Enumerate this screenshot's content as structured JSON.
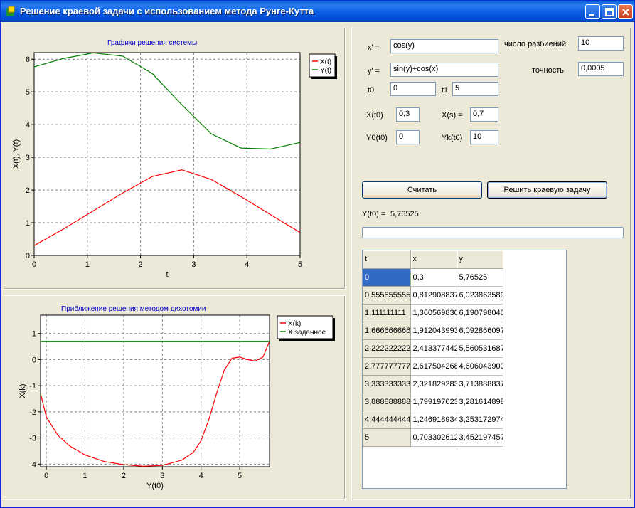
{
  "window": {
    "title": "Решение краевой задачи с использованием метода Рунге-Кутта"
  },
  "colors": {
    "accent_blue": "#0000c8",
    "series_red": "#ff0000",
    "series_green": "#008000"
  },
  "params": {
    "x_prime_label": "x' =",
    "x_prime_value": "cos(y)",
    "y_prime_label": "y' =",
    "y_prime_value": "sin(y)+cos(x)",
    "partitions_label": "число разбиений",
    "partitions_value": "10",
    "accuracy_label": "точность",
    "accuracy_value": "0,0005",
    "t0_label": "t0",
    "t0_value": "0",
    "t1_label": "t1",
    "t1_value": "5",
    "xt0_label": "X(t0)",
    "xt0_value": "0,3",
    "xs_label": "X(s) =",
    "xs_value": "0,7",
    "y0t0_label": "Y0(t0)",
    "y0t0_value": "0",
    "ykt0_label": "Yk(t0)",
    "ykt0_value": "10"
  },
  "buttons": {
    "compute": "Считать",
    "solve": "Решить краевую задачу"
  },
  "result": {
    "label": "Y(t0) =",
    "value": "5,76525"
  },
  "table": {
    "headers": [
      "t",
      "x",
      "y"
    ],
    "rows": [
      [
        "0",
        "0,3",
        "5,76525"
      ],
      [
        "0,555555555",
        "0,812908837",
        "6,023863589"
      ],
      [
        "1,111111111",
        "1,360569830",
        "6,190798040"
      ],
      [
        "1,666666666",
        "1,912043993",
        "6,092866097"
      ],
      [
        "2,222222222",
        "2,413377442",
        "5,560531687"
      ],
      [
        "2,777777777",
        "2,617504268",
        "4,606043900"
      ],
      [
        "3,333333333",
        "2,321829283",
        "3,713888837"
      ],
      [
        "3,888888888",
        "1,799197023",
        "3,281614898"
      ],
      [
        "4,444444444",
        "1,246918934",
        "3,253172974"
      ],
      [
        "5",
        "0,703302612",
        "3,452197457"
      ]
    ]
  },
  "chart_data": [
    {
      "type": "line",
      "title": "Графики решения системы",
      "xlabel": "t",
      "ylabel": "X(t), Y(t)",
      "xlim": [
        0,
        5
      ],
      "ylim": [
        0,
        6.2
      ],
      "xticks": [
        "0",
        "1",
        "2",
        "3",
        "4",
        "5"
      ],
      "yticks": [
        "0",
        "1",
        "2",
        "3",
        "4",
        "5",
        "6"
      ],
      "grid": true,
      "legend": "top-right",
      "series": [
        {
          "name": "X(t)",
          "color": "#ff0000",
          "x": [
            0,
            0.5556,
            1.1111,
            1.6667,
            2.2222,
            2.7778,
            3.3333,
            3.8889,
            4.4444,
            5
          ],
          "y": [
            0.3,
            0.813,
            1.361,
            1.912,
            2.413,
            2.618,
            2.322,
            1.799,
            1.247,
            0.703
          ]
        },
        {
          "name": "Y(t)",
          "color": "#008000",
          "x": [
            0,
            0.5556,
            1.1111,
            1.6667,
            2.2222,
            2.7778,
            3.3333,
            3.8889,
            4.4444,
            5
          ],
          "y": [
            5.765,
            6.024,
            6.191,
            6.093,
            5.561,
            4.606,
            3.714,
            3.282,
            3.253,
            3.452
          ]
        }
      ]
    },
    {
      "type": "line",
      "title": "Приближение решения методом дихотомии",
      "xlabel": "Y(t0)",
      "ylabel": "X(k)",
      "xlim": [
        -0.15,
        5.77
      ],
      "ylim": [
        -4.1,
        1.7
      ],
      "xticks": [
        "0",
        "1",
        "2",
        "3",
        "4",
        "5"
      ],
      "yticks": [
        "1",
        "0",
        "-1",
        "-2",
        "-3",
        "-4"
      ],
      "grid": true,
      "legend": "top-right",
      "series": [
        {
          "name": "X(k)",
          "color": "#ff0000",
          "x": [
            -0.15,
            0.0,
            0.3,
            0.6,
            1.0,
            1.5,
            2.0,
            2.5,
            3.0,
            3.5,
            3.8,
            4.0,
            4.2,
            4.4,
            4.6,
            4.8,
            5.0,
            5.2,
            5.4,
            5.6,
            5.77
          ],
          "y": [
            -1.3,
            -2.2,
            -2.9,
            -3.3,
            -3.65,
            -3.9,
            -4.02,
            -4.08,
            -4.05,
            -3.85,
            -3.55,
            -3.1,
            -2.3,
            -1.3,
            -0.4,
            0.05,
            0.1,
            0.0,
            -0.05,
            0.1,
            0.7
          ]
        },
        {
          "name": "X заданное",
          "color": "#008000",
          "x": [
            -0.15,
            5.77
          ],
          "y": [
            0.7,
            0.7
          ]
        }
      ]
    }
  ]
}
